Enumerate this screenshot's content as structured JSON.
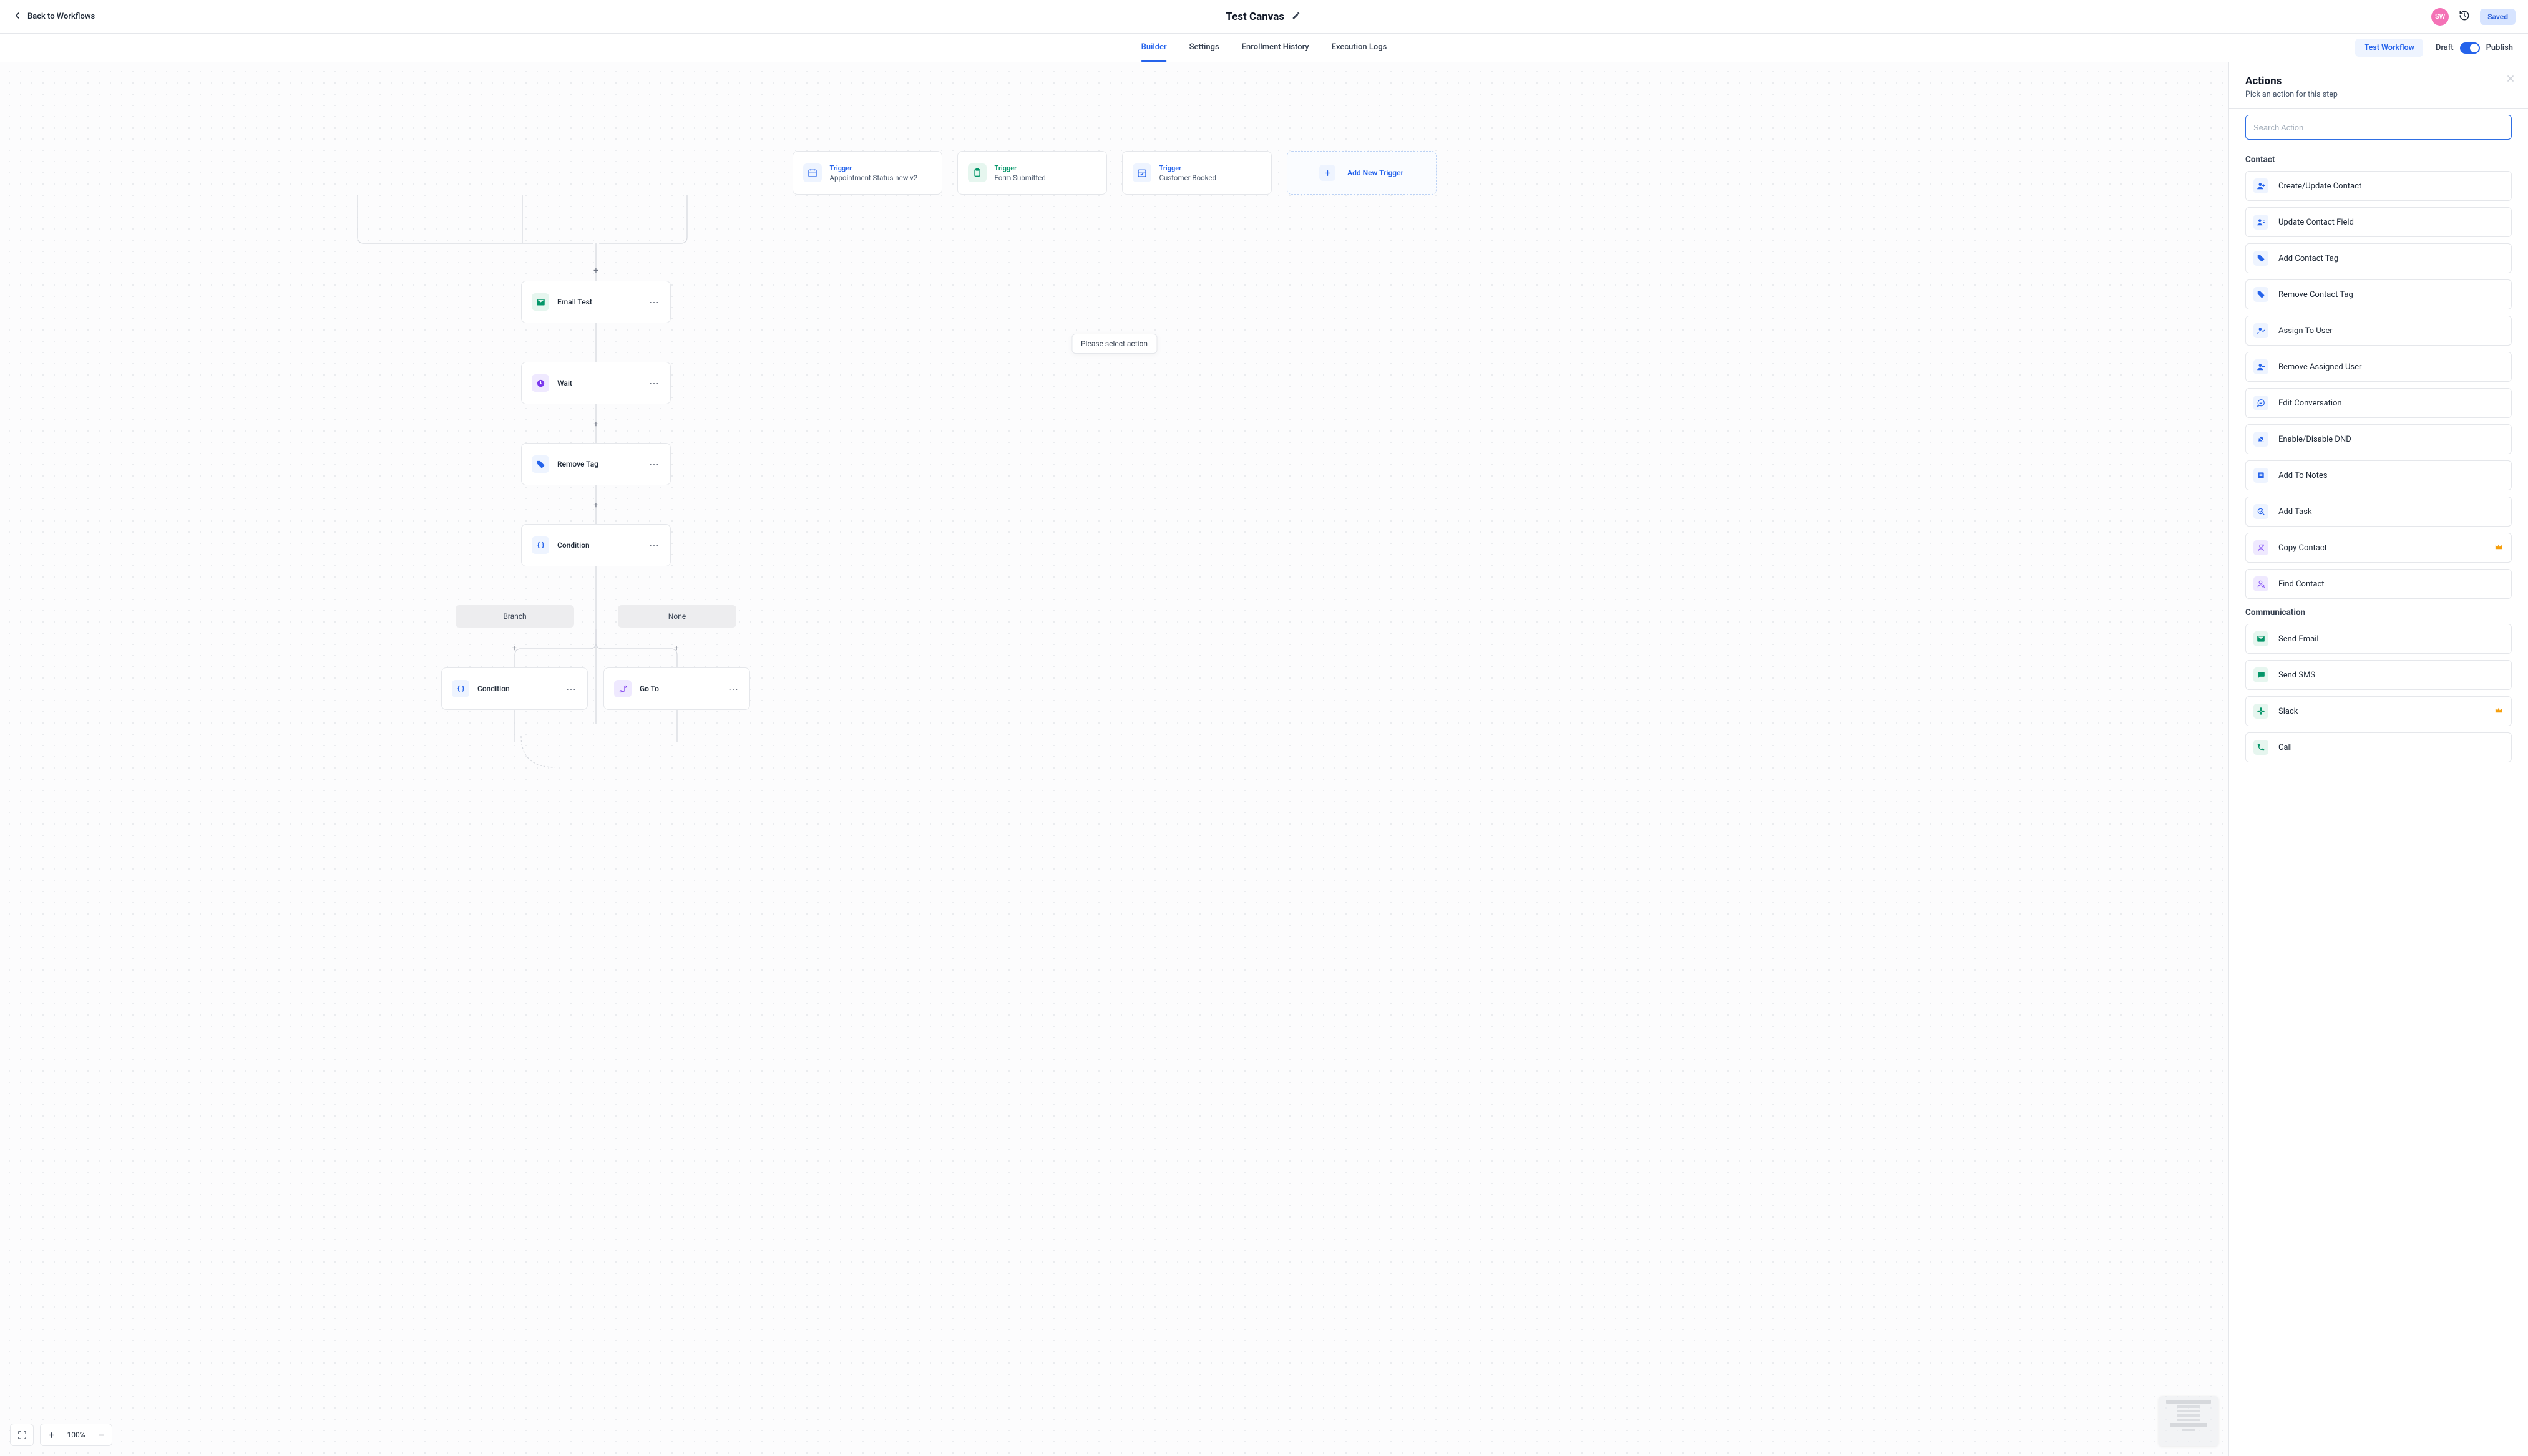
{
  "topbar": {
    "back_label": "Back to Workflows",
    "title": "Test Canvas",
    "avatar_initials": "SW",
    "saved_label": "Saved"
  },
  "tabs": {
    "builder": "Builder",
    "settings": "Settings",
    "enrollment": "Enrollment History",
    "execution": "Execution Logs",
    "test_workflow": "Test Workflow",
    "draft": "Draft",
    "publish": "Publish"
  },
  "canvas": {
    "triggers": [
      {
        "kind": "blue",
        "label": "Trigger",
        "sub": "Appointment Status new v2"
      },
      {
        "kind": "green",
        "label": "Trigger",
        "sub": "Form Submitted"
      },
      {
        "kind": "blue",
        "label": "Trigger",
        "sub": "Customer Booked"
      }
    ],
    "add_trigger": "Add New Trigger",
    "tooltip": "Please select action",
    "steps": {
      "email": "Email Test",
      "wait": "Wait",
      "remove_tag": "Remove Tag",
      "condition": "Condition",
      "branch": "Branch",
      "none": "None",
      "condition2": "Condition",
      "goto": "Go To"
    },
    "zoom": "100%"
  },
  "sidebar": {
    "title": "Actions",
    "subtitle": "Pick an action for this step",
    "search_placeholder": "Search Action",
    "categories": {
      "contact": "Contact",
      "communication": "Communication"
    },
    "contact_actions": [
      "Create/Update Contact",
      "Update Contact Field",
      "Add Contact Tag",
      "Remove Contact Tag",
      "Assign To User",
      "Remove Assigned User",
      "Edit Conversation",
      "Enable/Disable DND",
      "Add To Notes",
      "Add Task",
      "Copy Contact",
      "Find Contact"
    ],
    "comm_actions": [
      "Send Email",
      "Send SMS",
      "Slack",
      "Call"
    ]
  }
}
